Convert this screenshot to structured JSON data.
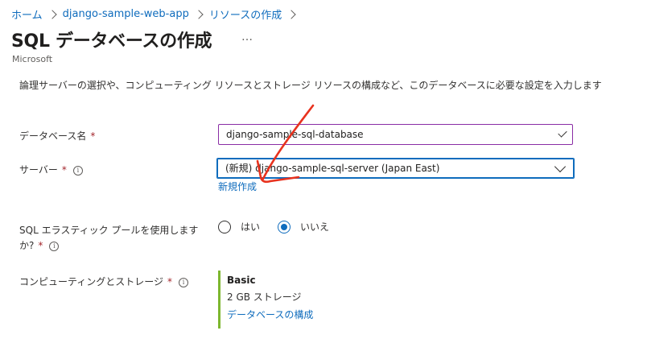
{
  "breadcrumb": {
    "items": [
      "ホーム",
      "django-sample-web-app",
      "リソースの作成"
    ]
  },
  "page": {
    "title": "SQL データベースの作成",
    "more": "…",
    "publisher": "Microsoft",
    "description": "論理サーバーの選択や、コンピューティング リソースとストレージ リソースの構成など、このデータベースに必要な設定を入力します"
  },
  "form": {
    "database_name": {
      "label": "データベース名",
      "required_mark": "*",
      "value": "django-sample-sql-database"
    },
    "server": {
      "label": "サーバー",
      "required_mark": "*",
      "value": "(新規) django-sample-sql-server (Japan East)",
      "create_new_link": "新規作成"
    },
    "elastic_pool": {
      "label_line1": "SQL エラスティック プールを使用します",
      "label_line2": "か?",
      "required_mark": "*",
      "options": [
        "はい",
        "いいえ"
      ],
      "selected": "いいえ"
    },
    "compute_storage": {
      "label": "コンピューティングとストレージ",
      "required_mark": "*",
      "tier": "Basic",
      "storage": "2 GB ストレージ",
      "configure_link": "データベースの構成"
    }
  },
  "colors": {
    "accent": "#0f6cbd",
    "annotation": "#e8321e",
    "tier_bar": "#7db72f",
    "required": "#a4262c"
  }
}
